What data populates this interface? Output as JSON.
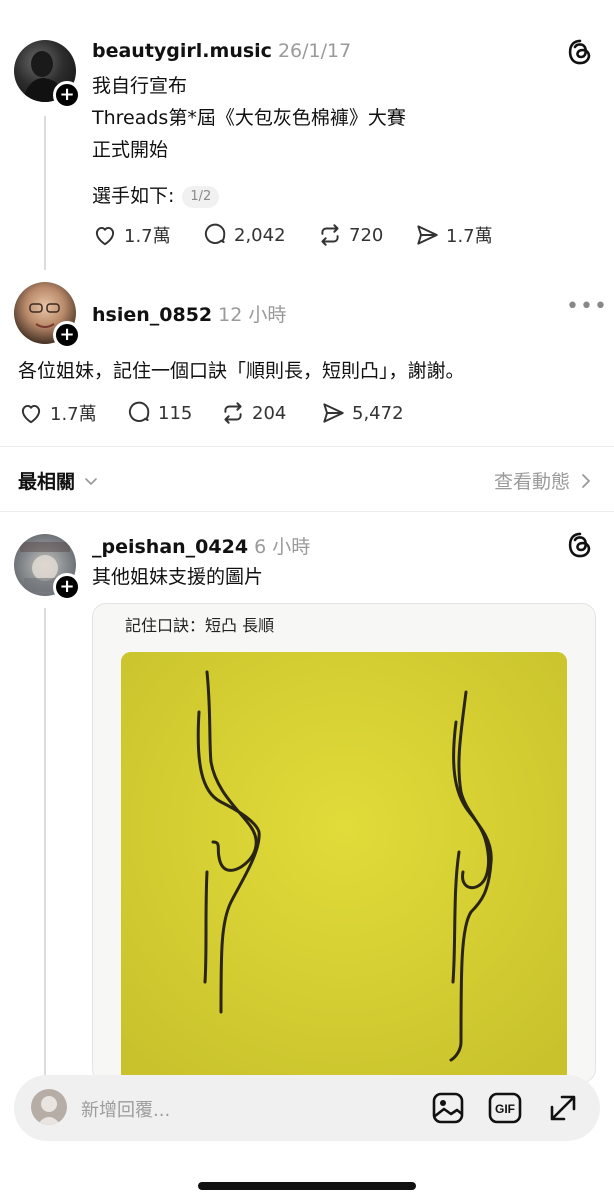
{
  "post1": {
    "username": "beautygirl.music",
    "time": "26/1/17",
    "lines": [
      "我自行宣布",
      "Threads第*屆《大包灰色棉褲》大賽",
      "正式開始"
    ],
    "list_intro": "選手如下:",
    "pager": "1/2",
    "likes": "1.7萬",
    "comments": "2,042",
    "reposts": "720",
    "shares": "1.7萬"
  },
  "post2": {
    "username": "hsien_0852",
    "time": "12 小時",
    "text": "各位姐妹，記住一個口訣「順則長，短則凸」，謝謝。",
    "likes": "1.7萬",
    "comments": "115",
    "reposts": "204",
    "shares": "5,472"
  },
  "sortbar": {
    "sort_label": "最相關",
    "activity_label": "查看動態"
  },
  "post3": {
    "username": "_peishan_0424",
    "time": "6 小時",
    "text": "其他姐妹支援的圖片",
    "image_caption": "記住口訣：短凸 長順"
  },
  "reply": {
    "placeholder": "新增回覆..."
  },
  "icons": {
    "like": "heart-icon",
    "comment": "comment-icon",
    "repost": "repost-icon",
    "share": "send-icon",
    "threads": "threads-logo-icon",
    "gallery": "image-icon",
    "gif": "gif-icon",
    "expand": "expand-icon"
  }
}
